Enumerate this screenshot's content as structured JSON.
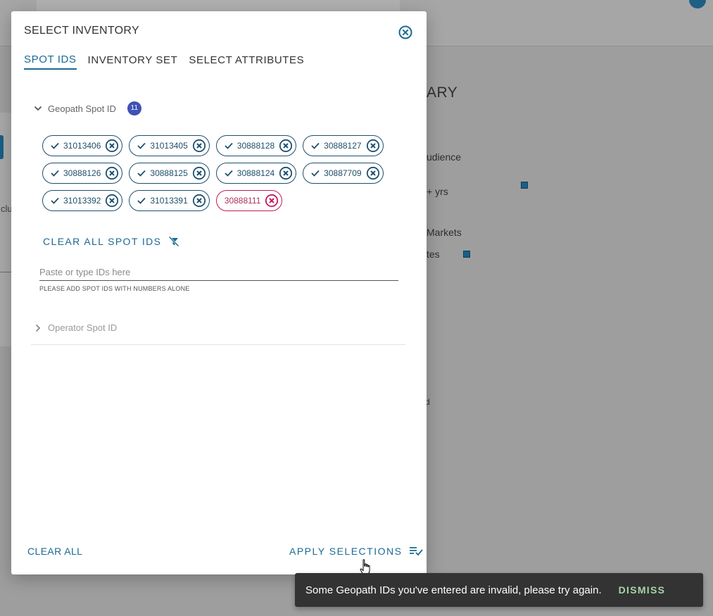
{
  "background": {
    "left_text": "clu",
    "title": "ARY",
    "items": [
      "udience",
      "+ yrs",
      "Markets",
      "tes",
      "d"
    ]
  },
  "modal": {
    "title": "SELECT INVENTORY",
    "close_icon": "close-circle-icon",
    "tabs": [
      {
        "label": "SPOT IDS",
        "active": true
      },
      {
        "label": "INVENTORY SET",
        "active": false
      },
      {
        "label": "SELECT ATTRIBUTES",
        "active": false
      }
    ],
    "geopath": {
      "label": "Geopath Spot ID",
      "count": "11",
      "expanded": true,
      "chips": [
        {
          "id": "31013406",
          "valid": true
        },
        {
          "id": "31013405",
          "valid": true
        },
        {
          "id": "30888128",
          "valid": true
        },
        {
          "id": "30888127",
          "valid": true
        },
        {
          "id": "30888126",
          "valid": true
        },
        {
          "id": "30888125",
          "valid": true
        },
        {
          "id": "30888124",
          "valid": true
        },
        {
          "id": "30887709",
          "valid": true
        },
        {
          "id": "31013392",
          "valid": true
        },
        {
          "id": "31013391",
          "valid": true
        },
        {
          "id": "30888111",
          "valid": false
        }
      ],
      "clear_label": "CLEAR ALL SPOT IDS",
      "input_placeholder": "Paste or type IDs here",
      "input_value": "",
      "hint": "PLEASE ADD SPOT IDS WITH NUMBERS ALONE"
    },
    "operator": {
      "label": "Operator Spot ID",
      "expanded": false
    },
    "footer": {
      "clear_all": "CLEAR ALL",
      "apply": "APPLY SELECTIONS"
    }
  },
  "snackbar": {
    "message": "Some Geopath IDs you've entered are invalid, please try again.",
    "action": "DISMISS"
  },
  "colors": {
    "accent": "#1b6a93",
    "badge": "#3f51b5",
    "invalid": "#c2185b",
    "snackbar_bg": "#333333",
    "snackbar_action": "#a5d6a7"
  }
}
